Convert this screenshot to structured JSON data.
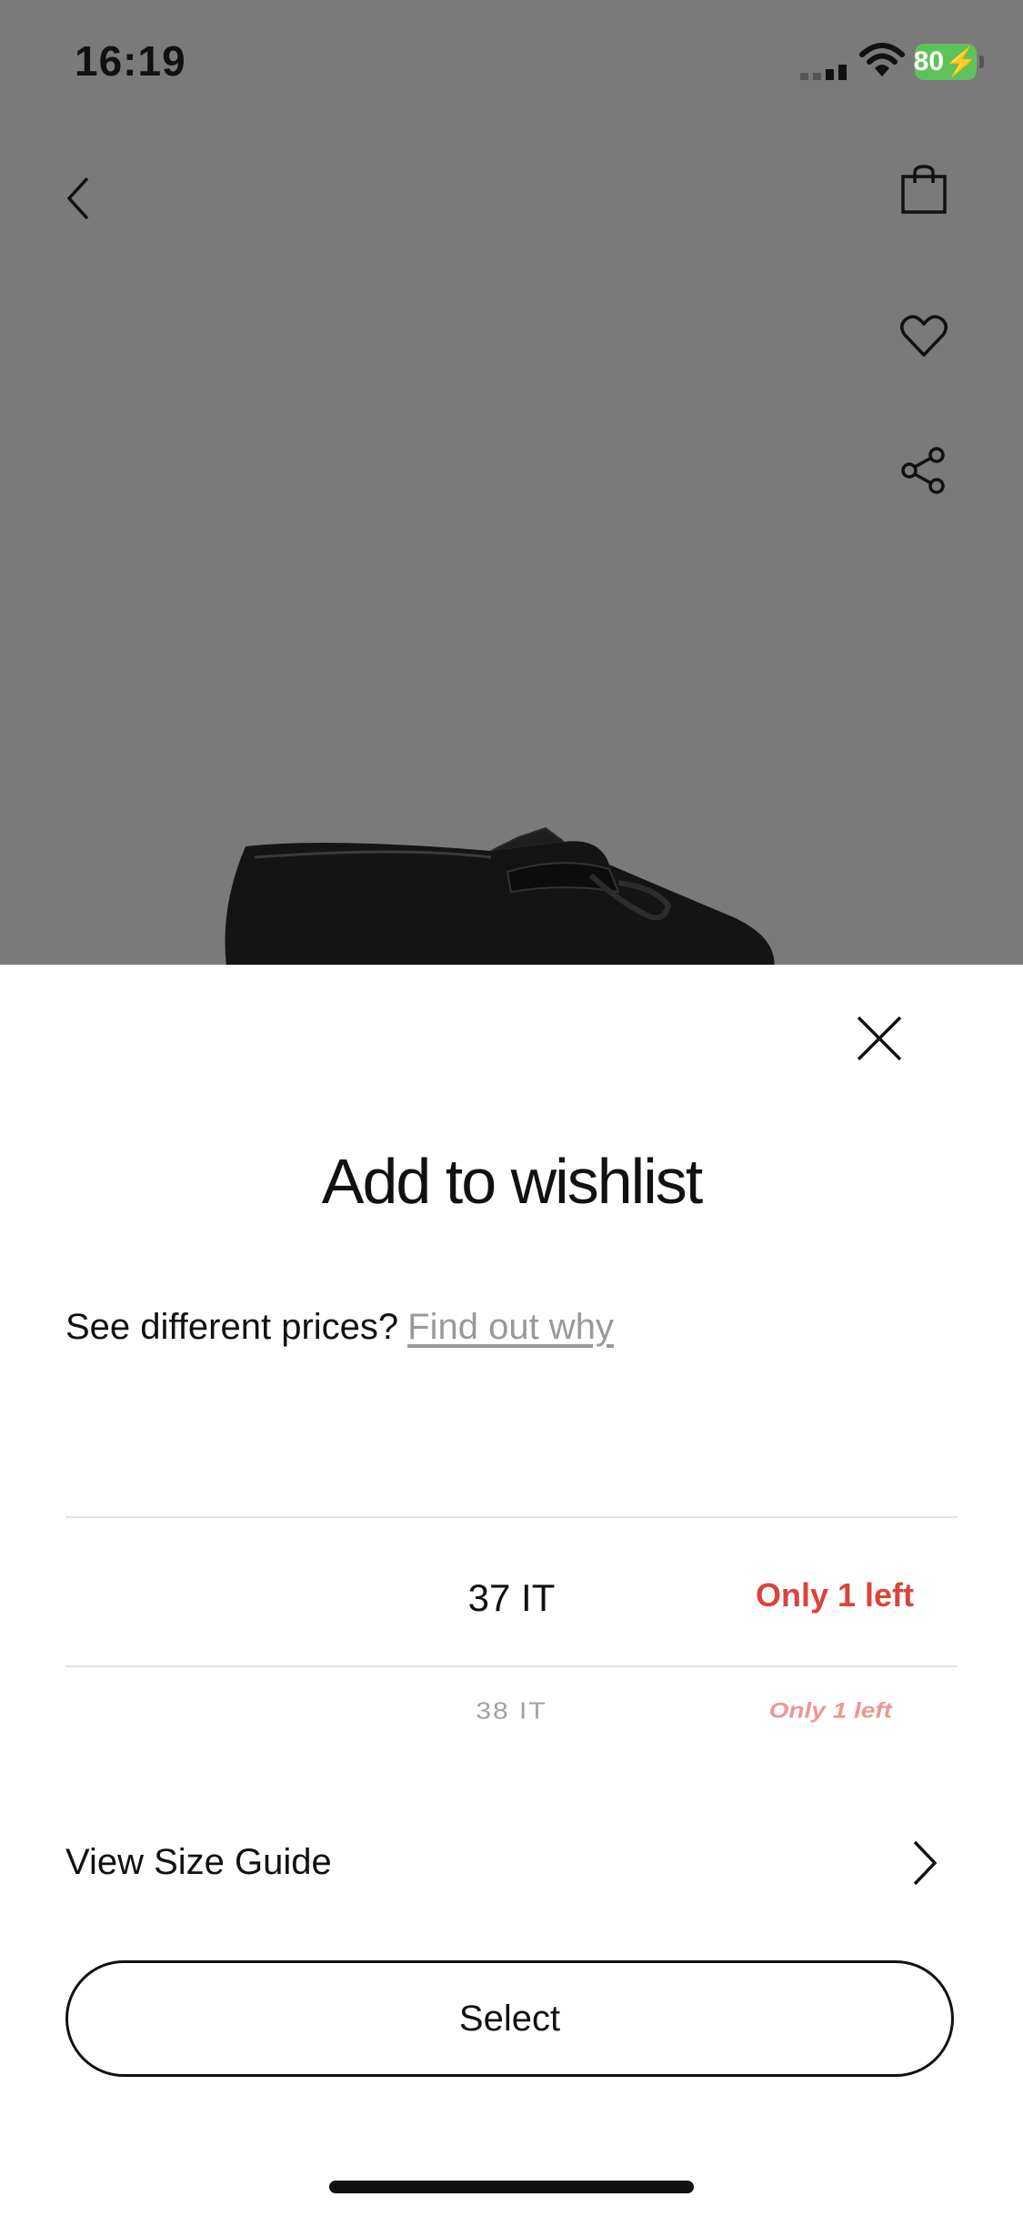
{
  "status_bar": {
    "time": "16:19",
    "battery": "80"
  },
  "sheet": {
    "title": "Add to wishlist",
    "prices_question": "See different prices?",
    "prices_link": "Find out why",
    "sizes": [
      {
        "size": "37 IT",
        "stock": "Only 1 left"
      },
      {
        "size": "38 IT",
        "stock": "Only 1 left"
      }
    ],
    "size_guide_label": "View Size Guide",
    "select_label": "Select"
  },
  "colors": {
    "accent_red": "#d9453b",
    "battery_green": "#5fc15a",
    "overlay_gray": "#7a7a7a"
  }
}
